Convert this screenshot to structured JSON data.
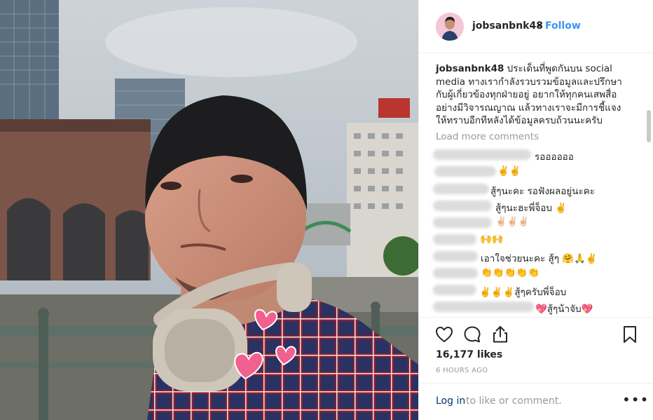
{
  "post": {
    "username": "jobsanbnk48",
    "separator": "•",
    "follow_label": "Follow",
    "caption_username": "jobsanbnk48",
    "caption_text": "ประเด็นที่พูดกันบน social media ทางเรากำลังรวบรวมข้อมูลและปรึกษากับผู้เกี่ยวข้องทุกฝ่ายอยู่ อยากให้ทุกคนเสพสื่ออย่างมีวิจารณญาณ แล้วทางเราจะมีการชี้แจงให้ทราบอีกทีหลังได้ข้อมูลครบถ้วนนะครับ",
    "load_more_label": "Load more comments",
    "likes_label": "16,177 likes",
    "time_label": "6 HOURS AGO",
    "login_link": "Log in",
    "login_rest": "to like or comment.",
    "more_label": "•••"
  },
  "comments": [
    {
      "text": "รออออออ"
    },
    {
      "text": "✌️✌️"
    },
    {
      "text": "สู้ๆนะคะ รอฟังผลอยู่นะคะ"
    },
    {
      "text": "สู้ๆนะฮะพี่จ็อบ ✌️"
    },
    {
      "text": "✌🏻✌🏻✌🏻"
    },
    {
      "text": "🙌🙌"
    },
    {
      "text": "เอาใจช่วยนะคะ สู้ๆ 🤗🙏✌️"
    },
    {
      "text": "👏👏👏👏👏"
    },
    {
      "text": "✌️✌️✌️สู้ๆครับพี่จ็อบ"
    },
    {
      "text": "💖สู้ๆน้าจับ💖"
    }
  ],
  "icons": {
    "like": "heart-icon",
    "comment": "comment-bubble-icon",
    "share": "share-icon",
    "save": "bookmark-icon"
  },
  "colors": {
    "follow": "#3897f0",
    "muted": "#999999",
    "link": "#003569",
    "border": "#efefef"
  }
}
